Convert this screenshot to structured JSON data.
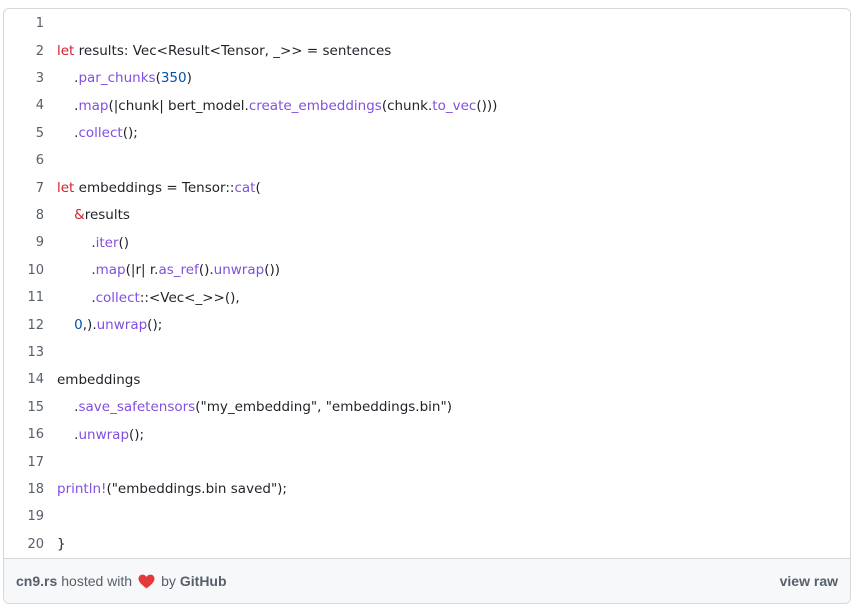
{
  "code": {
    "lines": [
      {
        "n": "1",
        "tokens": []
      },
      {
        "n": "2",
        "tokens": [
          {
            "t": "let",
            "c": "kw"
          },
          {
            "t": " results: Vec<Result<Tensor, _>> = sentences",
            "c": ""
          }
        ]
      },
      {
        "n": "3",
        "tokens": [
          {
            "t": "    .",
            "c": ""
          },
          {
            "t": "par_chunks",
            "c": "fn"
          },
          {
            "t": "(",
            "c": ""
          },
          {
            "t": "350",
            "c": "num"
          },
          {
            "t": ")",
            "c": ""
          }
        ]
      },
      {
        "n": "4",
        "tokens": [
          {
            "t": "    .",
            "c": ""
          },
          {
            "t": "map",
            "c": "fn"
          },
          {
            "t": "(|chunk| bert_model.",
            "c": ""
          },
          {
            "t": "create_embeddings",
            "c": "fn"
          },
          {
            "t": "(chunk.",
            "c": ""
          },
          {
            "t": "to_vec",
            "c": "fn"
          },
          {
            "t": "()))",
            "c": ""
          }
        ]
      },
      {
        "n": "5",
        "tokens": [
          {
            "t": "    .",
            "c": ""
          },
          {
            "t": "collect",
            "c": "fn"
          },
          {
            "t": "();",
            "c": ""
          }
        ]
      },
      {
        "n": "6",
        "tokens": []
      },
      {
        "n": "7",
        "tokens": [
          {
            "t": "let",
            "c": "kw"
          },
          {
            "t": " embeddings = Tensor::",
            "c": ""
          },
          {
            "t": "cat",
            "c": "fn"
          },
          {
            "t": "(",
            "c": ""
          }
        ]
      },
      {
        "n": "8",
        "tokens": [
          {
            "t": "    ",
            "c": ""
          },
          {
            "t": "&",
            "c": "kw"
          },
          {
            "t": "results",
            "c": ""
          }
        ]
      },
      {
        "n": "9",
        "tokens": [
          {
            "t": "        .",
            "c": ""
          },
          {
            "t": "iter",
            "c": "fn"
          },
          {
            "t": "()",
            "c": ""
          }
        ]
      },
      {
        "n": "10",
        "tokens": [
          {
            "t": "        .",
            "c": ""
          },
          {
            "t": "map",
            "c": "fn"
          },
          {
            "t": "(|r| r.",
            "c": ""
          },
          {
            "t": "as_ref",
            "c": "fn"
          },
          {
            "t": "().",
            "c": ""
          },
          {
            "t": "unwrap",
            "c": "fn"
          },
          {
            "t": "())",
            "c": ""
          }
        ]
      },
      {
        "n": "11",
        "tokens": [
          {
            "t": "        .",
            "c": ""
          },
          {
            "t": "collect",
            "c": "fn"
          },
          {
            "t": "::<Vec<_>>(),",
            "c": ""
          }
        ]
      },
      {
        "n": "12",
        "tokens": [
          {
            "t": "    ",
            "c": ""
          },
          {
            "t": "0",
            "c": "num"
          },
          {
            "t": ",).",
            "c": ""
          },
          {
            "t": "unwrap",
            "c": "fn"
          },
          {
            "t": "();",
            "c": ""
          }
        ]
      },
      {
        "n": "13",
        "tokens": []
      },
      {
        "n": "14",
        "tokens": [
          {
            "t": "embeddings",
            "c": ""
          }
        ]
      },
      {
        "n": "15",
        "tokens": [
          {
            "t": "    .",
            "c": ""
          },
          {
            "t": "save_safetensors",
            "c": "fn"
          },
          {
            "t": "(\"my_embedding\", \"embeddings.bin\")",
            "c": ""
          }
        ]
      },
      {
        "n": "16",
        "tokens": [
          {
            "t": "    .",
            "c": ""
          },
          {
            "t": "unwrap",
            "c": "fn"
          },
          {
            "t": "();",
            "c": ""
          }
        ]
      },
      {
        "n": "17",
        "tokens": []
      },
      {
        "n": "18",
        "tokens": [
          {
            "t": "println!",
            "c": "mac"
          },
          {
            "t": "(\"embeddings.bin saved\");",
            "c": ""
          }
        ]
      },
      {
        "n": "19",
        "tokens": []
      },
      {
        "n": "20",
        "tokens": [
          {
            "t": "}",
            "c": ""
          }
        ]
      }
    ]
  },
  "footer": {
    "file_link": "cn9.rs",
    "hosted_with": "hosted with",
    "by": "by",
    "host_link": "GitHub",
    "view_raw": "view raw",
    "heart_icon": "heart-icon",
    "heart_color": "#e5383b"
  },
  "colors": {
    "keyword": "#cf222e",
    "function": "#8250df",
    "number": "#0550ae",
    "text": "#1f2328",
    "line_number": "#57606a",
    "footer_bg": "#f6f8fa",
    "border": "#d6d9dc"
  }
}
